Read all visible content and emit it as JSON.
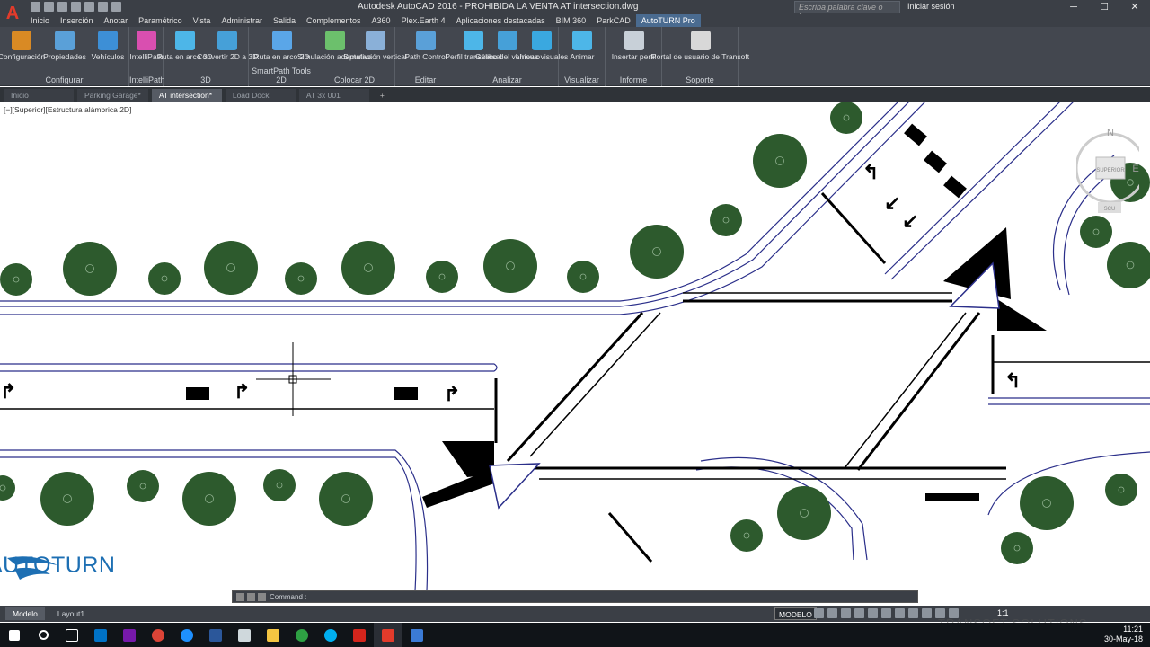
{
  "window": {
    "title": "Autodesk AutoCAD 2016 - PROHIBIDA LA VENTA    AT intersection.dwg",
    "search_placeholder": "Escriba palabra clave o frase",
    "login": "Iniciar sesión"
  },
  "menu_tabs": [
    "Inicio",
    "Inserción",
    "Anotar",
    "Paramétrico",
    "Vista",
    "Administrar",
    "Salida",
    "Complementos",
    "A360",
    "Plex.Earth 4",
    "Aplicaciones destacadas",
    "BIM 360",
    "ParkCAD",
    "AutoTURN Pro"
  ],
  "active_menu_tab": "AutoTURN Pro",
  "ribbon": {
    "groups": [
      {
        "label": "Configurar",
        "buttons": [
          "Configuración",
          "Propiedades",
          "Vehículos"
        ]
      },
      {
        "label": "IntelliPath",
        "buttons": [
          "IntelliPath"
        ]
      },
      {
        "label": "3D",
        "buttons": [
          "Ruta en arco 3D",
          "Convertir 2D a 3D"
        ]
      },
      {
        "label": "SmartPath Tools 2D",
        "buttons": [
          "Ruta en arco 2D"
        ]
      },
      {
        "label": "Colocar 2D",
        "buttons": [
          "Simulación adaptativa",
          "Simulación vertical"
        ]
      },
      {
        "label": "Editar",
        "buttons": [
          "Path Control"
        ]
      },
      {
        "label": "Analizar",
        "buttons": [
          "Perfil transversal",
          "Gálibo del vehículo",
          "Líneas visuales"
        ]
      },
      {
        "label": "Visualizar",
        "buttons": [
          "Animar"
        ]
      },
      {
        "label": "Informe",
        "buttons": [
          "Insertar perfil"
        ]
      },
      {
        "label": "Soporte",
        "buttons": [
          "Portal de usuario de Transoft"
        ]
      }
    ]
  },
  "doc_tabs": [
    "Inicio",
    "Parking Garage*",
    "AT intersection*",
    "Load Dock",
    "AT 3x 001"
  ],
  "active_doc_tab": "AT intersection*",
  "viewport_label": "[−][Superior][Estructura alámbrica 2D]",
  "navcube": {
    "north": "N",
    "east": "E",
    "face": "SUPERIOR",
    "wcs": "SCU"
  },
  "logo_text": "AUTOTURN",
  "command_placeholder": "Command :",
  "layout_tabs": [
    "Modelo",
    "Layout1"
  ],
  "active_layout_tab": "Modelo",
  "status": {
    "model": "MODELO",
    "scale": "1:1"
  },
  "clock": {
    "time": "11:21",
    "date": "30-May-18"
  },
  "watermark": "TRANSOFT SOLUTIONS",
  "colors": {
    "tree": "#2d5a2d",
    "road_outline": "#2b2f8a",
    "ribbon_bg": "#43474f",
    "accent": "#4a6b90"
  }
}
